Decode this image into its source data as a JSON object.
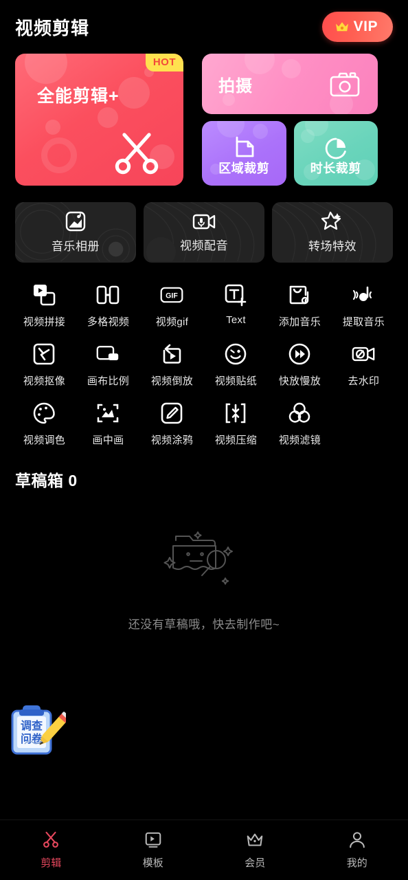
{
  "header": {
    "title": "视频剪辑",
    "vip_label": "VIP",
    "crown_icon": "crown-icon"
  },
  "hero": {
    "title": "全能剪辑+",
    "badge": "HOT",
    "icon": "scissors-icon",
    "colors": {
      "from": "#ff6b78",
      "to": "#f7455a",
      "badge_bg": "#ffe14f",
      "badge_fg": "#f24a3a"
    }
  },
  "promo_cards": [
    {
      "label": "拍摄",
      "icon": "camera-icon",
      "color": "#ff8fc4"
    },
    {
      "label": "区域裁剪",
      "icon": "crop-region-icon",
      "color": "#ab72fa"
    },
    {
      "label": "时长裁剪",
      "icon": "duration-pie-icon",
      "color": "#69d4bb"
    }
  ],
  "feature_cards": [
    {
      "label": "音乐相册",
      "icon": "music-album-icon"
    },
    {
      "label": "视频配音",
      "icon": "video-dubbing-icon"
    },
    {
      "label": "转场特效",
      "icon": "transition-effect-icon"
    }
  ],
  "tools": [
    [
      {
        "label": "视频拼接",
        "icon": "video-merge-icon"
      },
      {
        "label": "多格视频",
        "icon": "multi-grid-video-icon"
      },
      {
        "label": "视频gif",
        "icon": "gif-icon"
      },
      {
        "label": "Text",
        "icon": "text-add-icon"
      },
      {
        "label": "添加音乐",
        "icon": "add-music-icon"
      },
      {
        "label": "提取音乐",
        "icon": "extract-music-icon"
      }
    ],
    [
      {
        "label": "视频抠像",
        "icon": "video-matting-icon"
      },
      {
        "label": "画布比例",
        "icon": "canvas-ratio-icon"
      },
      {
        "label": "视频倒放",
        "icon": "video-reverse-icon"
      },
      {
        "label": "视频贴纸",
        "icon": "video-sticker-icon"
      },
      {
        "label": "快放慢放",
        "icon": "speed-icon"
      },
      {
        "label": "去水印",
        "icon": "remove-watermark-icon"
      }
    ],
    [
      {
        "label": "视频调色",
        "icon": "color-grading-icon"
      },
      {
        "label": "画中画",
        "icon": "picture-in-picture-icon"
      },
      {
        "label": "视频涂鸦",
        "icon": "video-doodle-icon"
      },
      {
        "label": "视频压缩",
        "icon": "video-compress-icon"
      },
      {
        "label": "视频滤镜",
        "icon": "video-filter-icon"
      }
    ]
  ],
  "drafts": {
    "title": "草稿箱 0",
    "count": 0,
    "empty_text": "还没有草稿哦，快去制作吧~",
    "empty_icon": "empty-folder-search-icon"
  },
  "survey": {
    "line1": "调查",
    "line2": "问卷",
    "icon": "survey-clipboard-icon"
  },
  "nav": [
    {
      "label": "剪辑",
      "icon": "scissors-icon",
      "active": true
    },
    {
      "label": "模板",
      "icon": "template-icon",
      "active": false
    },
    {
      "label": "会员",
      "icon": "crown-icon",
      "active": false
    },
    {
      "label": "我的",
      "icon": "person-icon",
      "active": false
    }
  ],
  "colors": {
    "accent": "#e8485e",
    "vip": "#ff5f52",
    "bg": "#000000"
  }
}
